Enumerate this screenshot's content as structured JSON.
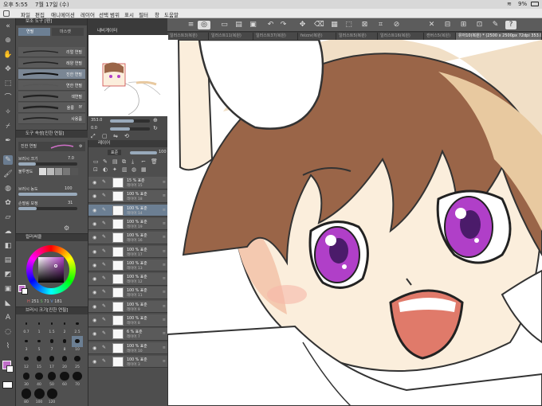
{
  "statusbar": {
    "time": "오후 5:55",
    "date": "7월 17일 (수)",
    "battery": "9%"
  },
  "menu": {
    "items": [
      "파일",
      "편집",
      "애니메이션",
      "레이어",
      "선택 범위",
      "표시",
      "필터",
      "창",
      "도움말"
    ]
  },
  "doc_tabs": [
    "일러스트3(복원)",
    "일러스트11(복원)",
    "일러스트37(복원)",
    "feizzv(복원)",
    "일러스트5(복원)",
    "일러스트16(복원)",
    "캔버스5(복원)",
    "유아10(복원) * (2500 x 2500px 72dpi 353.0%)"
  ],
  "subtool": {
    "header": "보조 도구 [펜]",
    "tab1": "연필",
    "tab2": "마스캣",
    "brushes": [
      {
        "name": "리얼 연필"
      },
      {
        "name": "레양 연필"
      },
      {
        "name": "진한 연필"
      },
      {
        "name": "연한 연필"
      },
      {
        "name": "색연필"
      },
      {
        "name": "울룽",
        "badge": "IY"
      },
      {
        "name": "사용품"
      }
    ]
  },
  "toolprop": {
    "header": "도구 속성[진한 연필]",
    "tool_name": "진한 연필",
    "brush_size_label": "브러시 크기",
    "brush_size": "7.0",
    "opacity_label": "불투명도",
    "brush_density_label": "브러시 농도",
    "brush_density": "100",
    "stabilization_label": "손떨림 보정",
    "stabilization": "31"
  },
  "color": {
    "header": "컬러써클",
    "h": "251",
    "s": "71",
    "v": "181",
    "fg": "#c06fc8"
  },
  "brushsize": {
    "header": "브러시 크기[진한 연필]",
    "sizes": [
      "0.7",
      "1",
      "1.5",
      "2",
      "2.5",
      "3",
      "5",
      "7",
      "8",
      "10",
      "12",
      "15",
      "17",
      "20",
      "25",
      "30",
      "40",
      "50",
      "60",
      "70",
      "80",
      "100",
      "120"
    ]
  },
  "navigator": {
    "header": "내비게이터",
    "zoom": "353.0",
    "angle": "0.0"
  },
  "layers": {
    "header": "레이어",
    "blend": "표준",
    "opacity": "100",
    "rows": [
      {
        "pct": "15 %",
        "mode": "표준",
        "name": "레이어 15"
      },
      {
        "pct": "100 %",
        "mode": "표준",
        "name": "레이어 18"
      },
      {
        "pct": "100 %",
        "mode": "표준",
        "name": "레이어 14",
        "selected": true
      },
      {
        "pct": "100 %",
        "mode": "표준",
        "name": "레이어 19"
      },
      {
        "pct": "100 %",
        "mode": "표준",
        "name": "레이어 16"
      },
      {
        "pct": "100 %",
        "mode": "표준",
        "name": "레이어 17"
      },
      {
        "pct": "100 %",
        "mode": "표준",
        "name": "레이어 13"
      },
      {
        "pct": "100 %",
        "mode": "표준",
        "name": "레이어 12"
      },
      {
        "pct": "100 %",
        "mode": "표준",
        "name": "레이어 11"
      },
      {
        "pct": "100 %",
        "mode": "표준",
        "name": "레이어 9"
      },
      {
        "pct": "100 %",
        "mode": "표준",
        "name": "레이어 8"
      },
      {
        "pct": "6 %",
        "mode": "표준",
        "name": "레이어 7"
      },
      {
        "pct": "100 %",
        "mode": "표준",
        "name": "레이어 10"
      },
      {
        "pct": "100 %",
        "mode": "표준",
        "name": "레이어 3"
      }
    ]
  },
  "colors": {
    "hair": "#9a6548",
    "hair_light": "#e8c9a0",
    "skin": "#fbeedc",
    "iris": "#b03fc8",
    "mouth": "#e07a6a"
  }
}
